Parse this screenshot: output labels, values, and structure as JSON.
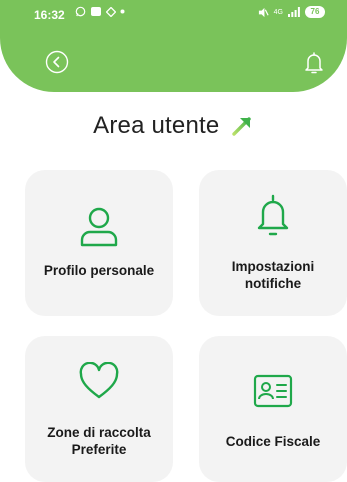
{
  "status_bar": {
    "time": "16:32",
    "battery": "76",
    "network": "4G"
  },
  "page": {
    "title": "Area utente"
  },
  "colors": {
    "accent": "#7ac35a",
    "icon_green": "#1fa84a",
    "card_bg": "#f3f3f3"
  },
  "cards": [
    {
      "label": "Profilo personale",
      "icon": "user-icon"
    },
    {
      "label": "Impostazioni notifiche",
      "icon": "bell-icon"
    },
    {
      "label": "Zone di raccolta Preferite",
      "icon": "heart-icon"
    },
    {
      "label": "Codice Fiscale",
      "icon": "id-card-icon"
    }
  ]
}
